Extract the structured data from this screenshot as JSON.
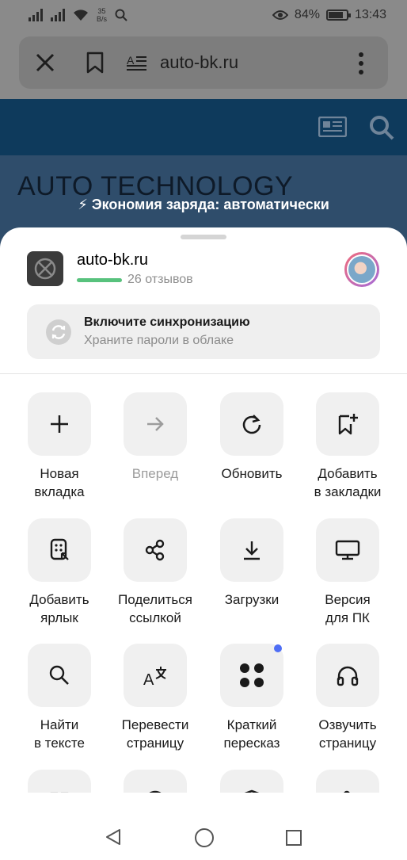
{
  "status_bar": {
    "net_speed_value": "35",
    "net_speed_unit": "B/s",
    "battery_percent": "84%",
    "battery_level": 0.84,
    "time": "13:43"
  },
  "browser": {
    "url": "auto-bk.ru"
  },
  "website": {
    "title": "AUTO TECHNOLOGY",
    "battery_saver_notice": "⚡ Экономия заряда: автоматически"
  },
  "sheet": {
    "site_name": "auto-bk.ru",
    "reviews": "26 отзывов",
    "sync": {
      "title": "Включите синхронизацию",
      "subtitle": "Храните пароли в облаке"
    },
    "actions": [
      {
        "label": "Новая\nвкладка",
        "icon": "plus-icon",
        "enabled": true
      },
      {
        "label": "Вперед",
        "icon": "arrow-right-icon",
        "enabled": false
      },
      {
        "label": "Обновить",
        "icon": "refresh-icon",
        "enabled": true
      },
      {
        "label": "Добавить\nв закладки",
        "icon": "bookmark-add-icon",
        "enabled": true
      },
      {
        "label": "Добавить\nярлык",
        "icon": "shortcut-icon",
        "enabled": true
      },
      {
        "label": "Поделиться\nссылкой",
        "icon": "share-icon",
        "enabled": true
      },
      {
        "label": "Загрузки",
        "icon": "download-icon",
        "enabled": true
      },
      {
        "label": "Версия\nдля ПК",
        "icon": "desktop-icon",
        "enabled": true
      },
      {
        "label": "Найти\nв тексте",
        "icon": "search-icon",
        "enabled": true
      },
      {
        "label": "Перевести\nстраницу",
        "icon": "translate-icon",
        "enabled": true
      },
      {
        "label": "Краткий\nпересказ",
        "icon": "summary-icon",
        "enabled": true
      },
      {
        "label": "Озвучить\nстраницу",
        "icon": "headphones-icon",
        "enabled": true
      },
      {
        "label": "",
        "icon": "open-external-icon",
        "enabled": true
      },
      {
        "label": "",
        "icon": "block-icon",
        "enabled": true
      },
      {
        "label": "",
        "icon": "shield-icon",
        "enabled": true
      },
      {
        "label": "",
        "icon": "puzzle-icon",
        "enabled": true
      }
    ]
  },
  "colors": {
    "accent_green": "#58c27d",
    "badge_blue": "#4f6ef5",
    "site_header": "#0e3a5c"
  }
}
